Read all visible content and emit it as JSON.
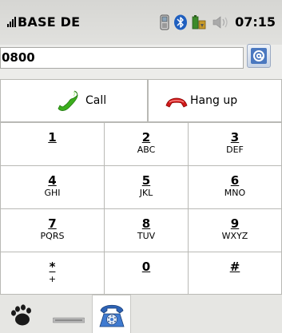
{
  "status": {
    "carrier": "BASE DE",
    "time": "07:15",
    "icons": [
      "signal-icon",
      "phone-icon",
      "bluetooth-icon",
      "battery-icon",
      "volume-icon"
    ]
  },
  "dialer": {
    "number": "0800",
    "call_label": "Call",
    "hangup_label": "Hang up",
    "keys": [
      {
        "digit": "1",
        "letters": ""
      },
      {
        "digit": "2",
        "letters": "ABC"
      },
      {
        "digit": "3",
        "letters": "DEF"
      },
      {
        "digit": "4",
        "letters": "GHI"
      },
      {
        "digit": "5",
        "letters": "JKL"
      },
      {
        "digit": "6",
        "letters": "MNO"
      },
      {
        "digit": "7",
        "letters": "PQRS"
      },
      {
        "digit": "8",
        "letters": "TUV"
      },
      {
        "digit": "9",
        "letters": "WXYZ"
      },
      {
        "digit": "*",
        "letters": "+"
      },
      {
        "digit": "0",
        "letters": ""
      },
      {
        "digit": "#",
        "letters": ""
      }
    ]
  },
  "taskbar": {
    "items": [
      "foot-icon",
      "keyboard-icon",
      "telephone-icon"
    ],
    "active": "telephone-icon"
  },
  "colors": {
    "call_green": "#3cae1e",
    "hangup_red": "#d01818",
    "status_bar": "#dcdcd9",
    "background": "#ececea"
  }
}
